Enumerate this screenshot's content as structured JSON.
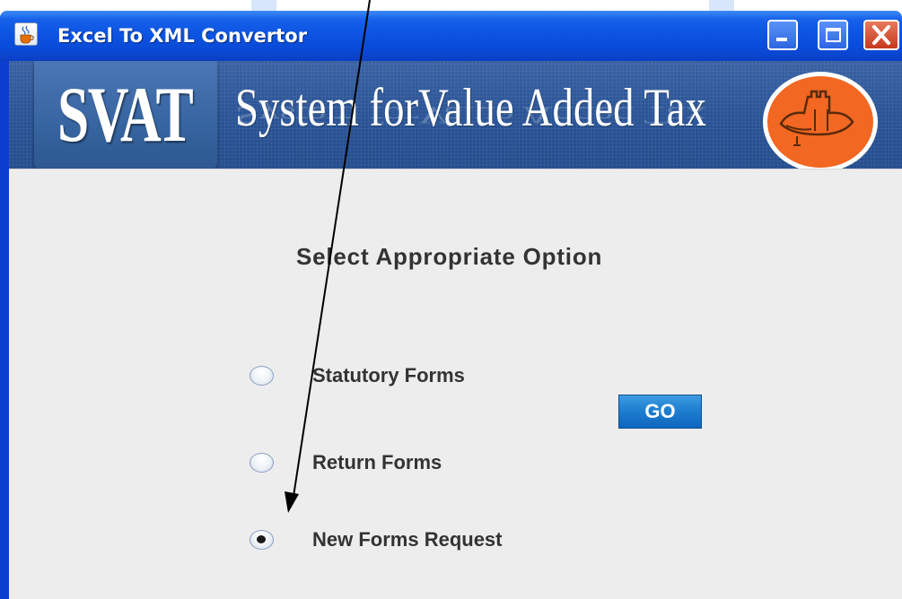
{
  "window": {
    "title": "Excel To XML Convertor",
    "icons": {
      "app": "java-cup-icon",
      "minimize": "minimize-icon",
      "maximize": "maximize-icon",
      "close": "close-icon"
    }
  },
  "banner": {
    "logo_text": "SVAT",
    "title": "System forValue Added Tax",
    "emblem": "state-emblem-icon"
  },
  "main": {
    "heading": "Select Appropriate Option",
    "options": [
      {
        "label": "Statutory Forms",
        "selected": false
      },
      {
        "label": "Return Forms",
        "selected": false
      },
      {
        "label": "New Forms Request",
        "selected": true
      }
    ],
    "go_label": "GO"
  },
  "colors": {
    "titlebar": "#0a49d6",
    "banner": "#2a5496",
    "go_button": "#1f7fd2",
    "emblem": "#f26722",
    "content_bg": "#ededed"
  }
}
